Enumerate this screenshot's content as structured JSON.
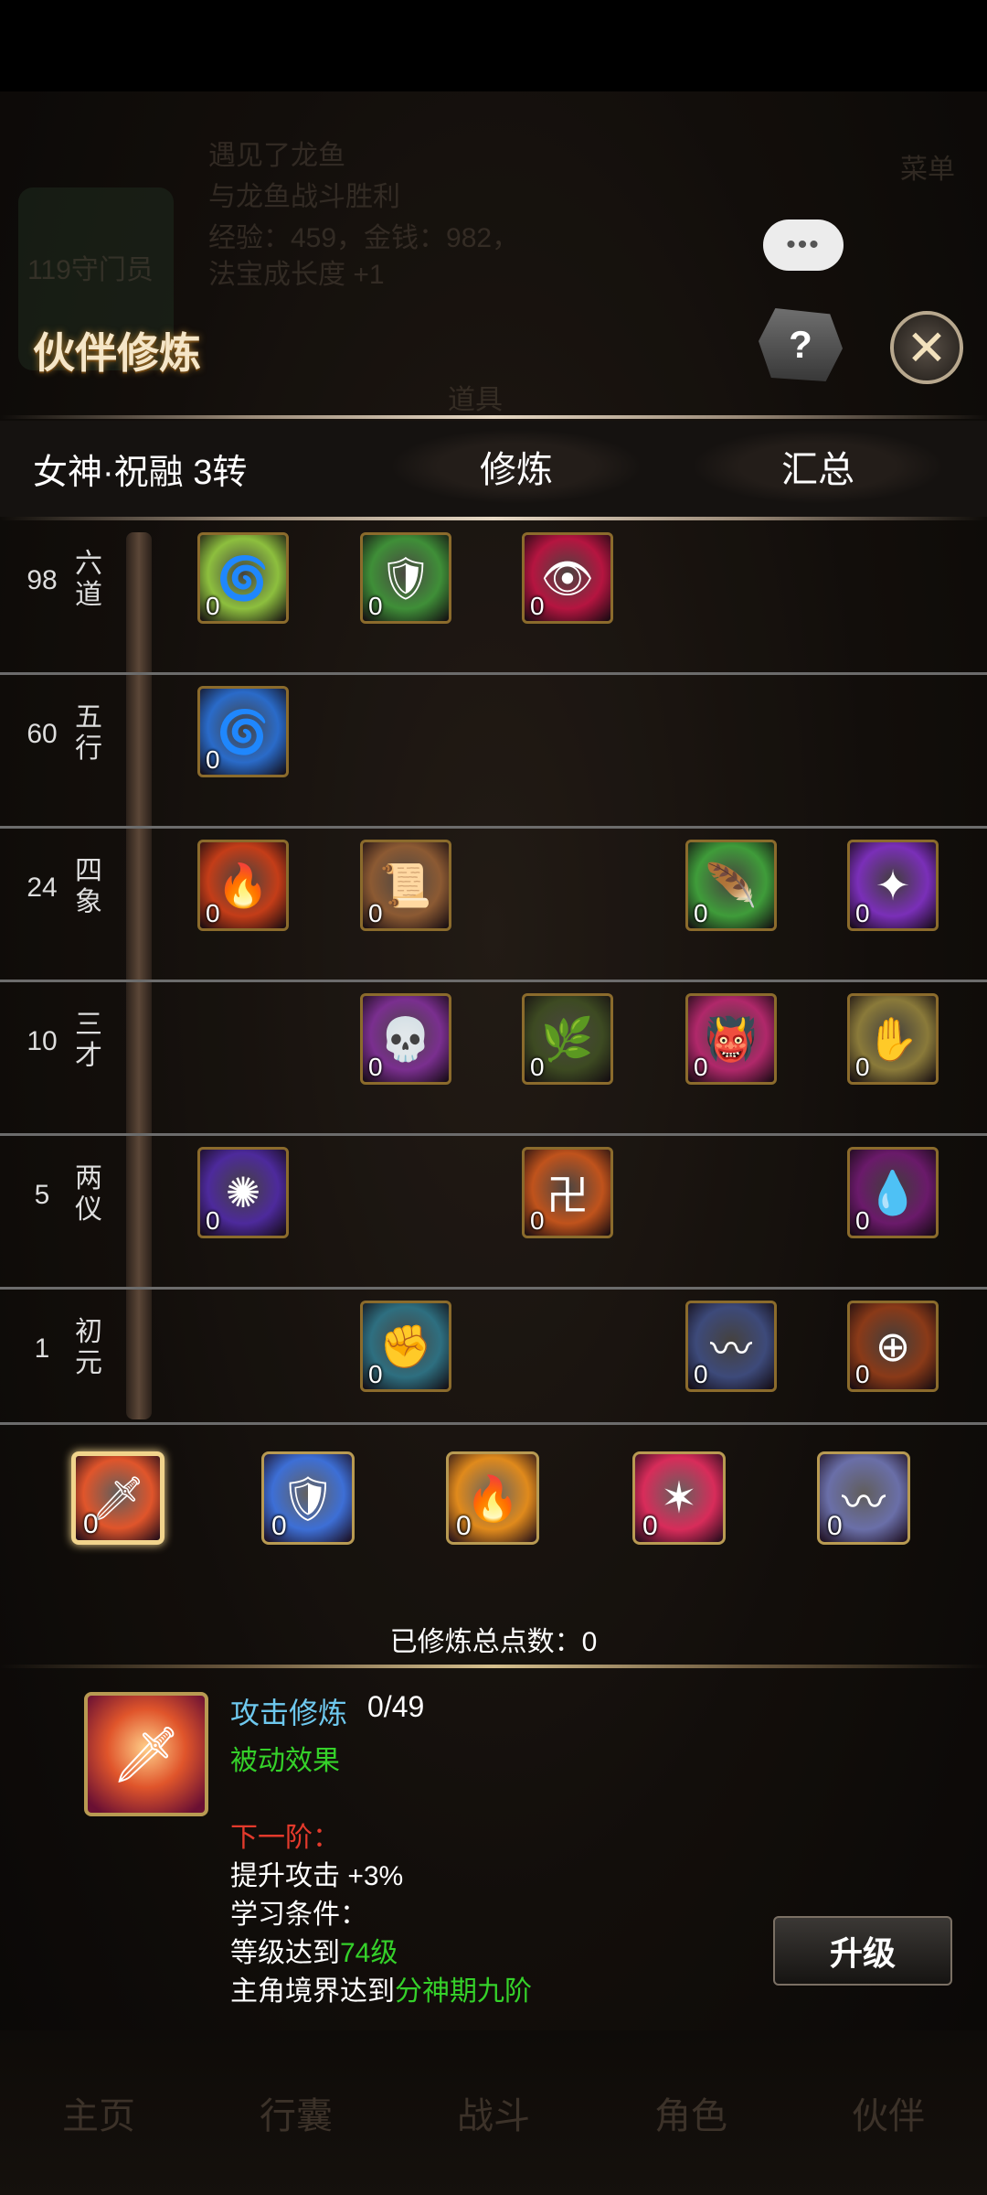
{
  "background": {
    "player_rank": "119守门员",
    "news_title": "遇见了龙鱼",
    "news_line1": "与龙鱼战斗胜利",
    "news_line2": "经验：459，金钱：982，",
    "news_line3": "法宝成长度 +1",
    "menu_label": "菜单",
    "item_label": "道具",
    "nav": [
      "主页",
      "行囊",
      "战斗",
      "角色",
      "伙伴"
    ]
  },
  "header": {
    "title": "伙伴修炼",
    "help_label": "?",
    "chat_label": "•••"
  },
  "tabs": {
    "partner_name": "女神·祝融 3转",
    "train": "修炼",
    "summary": "汇总"
  },
  "tiers": [
    {
      "level": "98",
      "name": "六道",
      "skills": [
        {
          "icon": "green-spiral-icon",
          "count": "0",
          "color": "#8dbf3e"
        },
        {
          "icon": "green-leaf-shield-icon",
          "count": "0",
          "color": "#3f8f38"
        },
        {
          "icon": "red-eye-icon",
          "count": "0",
          "color": "#b51540"
        }
      ]
    },
    {
      "level": "60",
      "name": "五行",
      "skills": [
        {
          "icon": "blue-swirl-icon",
          "count": "0",
          "color": "#2a6bc9"
        }
      ]
    },
    {
      "level": "24",
      "name": "四象",
      "skills": [
        {
          "icon": "fire-swirl-icon",
          "count": "0",
          "color": "#c43d18"
        },
        {
          "icon": "scroll-icon",
          "count": "0",
          "color": "#8c5a33"
        },
        {
          "icon": "green-wing-icon",
          "count": "0",
          "color": "#3f9c3a"
        },
        {
          "icon": "purple-star-icon",
          "count": "0",
          "color": "#7a2fb8"
        }
      ]
    },
    {
      "level": "10",
      "name": "三才",
      "skills": [
        {
          "icon": "skull-icon",
          "count": "0",
          "color": "#7a2f8f"
        },
        {
          "icon": "dark-plant-icon",
          "count": "0",
          "color": "#3d4a22"
        },
        {
          "icon": "red-demon-icon",
          "count": "0",
          "color": "#b0286a"
        },
        {
          "icon": "black-hand-icon",
          "count": "0",
          "color": "#8a7a3a"
        }
      ]
    },
    {
      "level": "5",
      "name": "两仪",
      "skills": [
        {
          "icon": "purple-aura-icon",
          "count": "0",
          "color": "#4d2a9c"
        },
        {
          "icon": "red-rune-icon",
          "count": "0",
          "color": "#c0531c"
        },
        {
          "icon": "purple-tear-icon",
          "count": "0",
          "color": "#6a1a6a"
        }
      ]
    },
    {
      "level": "1",
      "name": "初元",
      "skills": [
        {
          "icon": "fist-icon",
          "count": "0",
          "color": "#2e6f80"
        },
        {
          "icon": "blue-slash-icon",
          "count": "0",
          "color": "#3d4a7a"
        },
        {
          "icon": "crosshair-icon",
          "count": "0",
          "color": "#8a3a18"
        }
      ]
    }
  ],
  "base_skills": [
    {
      "icon": "attack-icon",
      "count": "0",
      "color": "#e0552b"
    },
    {
      "icon": "shield-icon",
      "count": "0",
      "color": "#3d6fd6"
    },
    {
      "icon": "fire-body-icon",
      "count": "0",
      "color": "#e08a1c"
    },
    {
      "icon": "red-burst-icon",
      "count": "0",
      "color": "#d82c5a"
    },
    {
      "icon": "wind-slash-icon",
      "count": "0",
      "color": "#6a6fa8"
    }
  ],
  "total_label": "已修炼总点数：",
  "total_value": "0",
  "detail": {
    "name": "攻击修炼",
    "progress": "0/49",
    "passive": "被动效果",
    "next_label": "下一阶：",
    "effect": "提升攻击 +3%",
    "condition_label": "学习条件：",
    "cond1_prefix": "等级达到",
    "cond1_value": "74级",
    "cond2_prefix": "主角境界达到",
    "cond2_value": "分神期九阶"
  },
  "upgrade_label": "升级"
}
